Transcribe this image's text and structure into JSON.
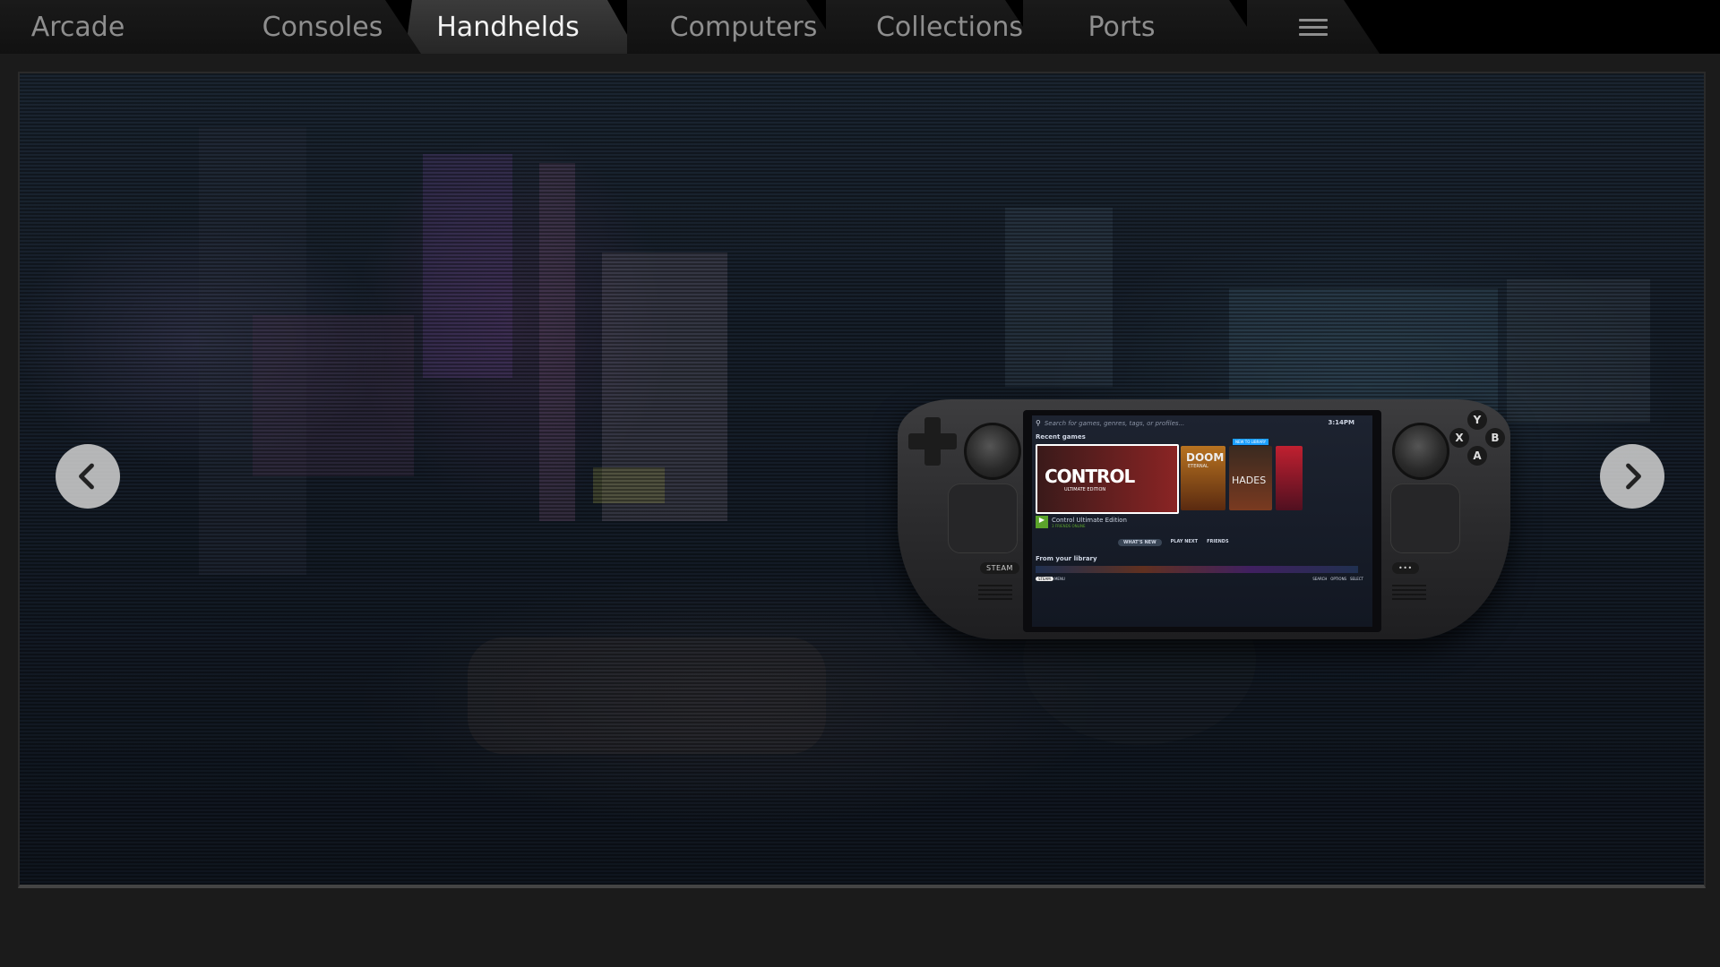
{
  "tabs": [
    {
      "label": "Arcade",
      "active": false
    },
    {
      "label": "Consoles",
      "active": false
    },
    {
      "label": "Handhelds",
      "active": true
    },
    {
      "label": "Computers",
      "active": false
    },
    {
      "label": "Collections",
      "active": false
    },
    {
      "label": "Ports",
      "active": false
    }
  ],
  "menu_icon": "hamburger-icon",
  "carousel": {
    "prev_icon": "chevron-left-icon",
    "next_icon": "chevron-right-icon"
  },
  "device": {
    "steam_label": "STEAM",
    "dots_label": "•••",
    "face_buttons": {
      "y": "Y",
      "x": "X",
      "b": "B",
      "a": "A"
    },
    "screen": {
      "search_placeholder": "Search for games, genres, tags, or profiles...",
      "clock": "3:14PM",
      "recent_heading": "Recent games",
      "featured_title": "CONTROL",
      "featured_subtitle": "ULTIMATE EDITION",
      "tile_doom": "DOOM",
      "tile_doom_sub": "ETERNAL",
      "tile_hades": "HADES",
      "new_badge": "NEW TO LIBRARY",
      "now_playing_title": "Control Ultimate Edition",
      "now_playing_sub": "3 FRIENDS ONLINE",
      "tabs": [
        "WHAT'S NEW",
        "PLAY NEXT",
        "FRIENDS"
      ],
      "library_heading": "From your library",
      "footer_steam": "STEAM",
      "footer_menu": "MENU",
      "footer_search": "SEARCH",
      "footer_options": "OPTIONS",
      "footer_select": "SELECT"
    }
  },
  "colors": {
    "tab_active_text": "#f2f2f2",
    "tab_inactive_text": "#8e8e8e",
    "accent_blue": "#1a9fff",
    "play_green": "#5ba32b"
  }
}
